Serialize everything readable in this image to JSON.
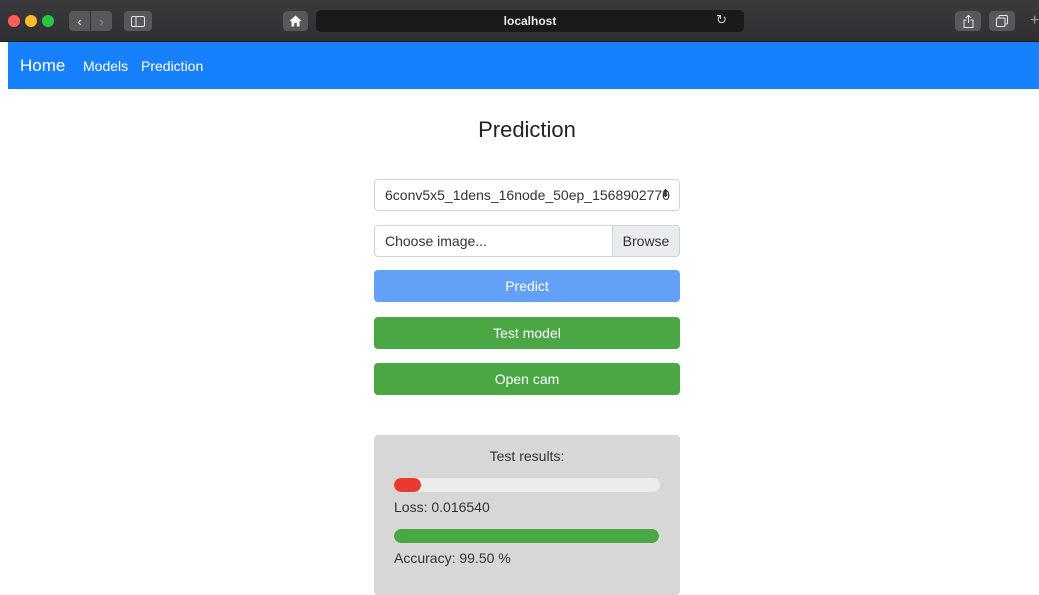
{
  "browser": {
    "url": "localhost"
  },
  "navbar": {
    "brand": "Home",
    "links": [
      "Models",
      "Prediction"
    ],
    "color": "#1780fd"
  },
  "main": {
    "title": "Prediction",
    "model_select": {
      "selected": "6conv5x5_1dens_16node_50ep_1568902770"
    },
    "file_input": {
      "label": "Choose image...",
      "browse_label": "Browse"
    },
    "buttons": {
      "predict": "Predict",
      "test_model": "Test model",
      "open_cam": "Open cam"
    },
    "results": {
      "heading": "Test results:",
      "loss_text": "Loss: 0.016540",
      "accuracy_text": "Accuracy: 99.50 %",
      "loss_bar_fraction": 0.1,
      "accuracy_bar_fraction": 0.995,
      "loss_color": "#ea3a2f",
      "accuracy_color": "#4aa743"
    }
  }
}
